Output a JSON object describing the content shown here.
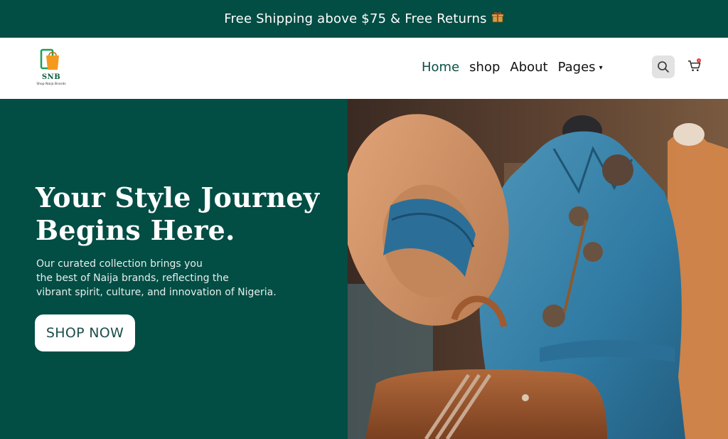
{
  "announcement": {
    "text": "Free Shipping above $75 & Free Returns",
    "icon": "gift-icon"
  },
  "brand": {
    "name": "SNB",
    "tagline": "Shop Naija Brands",
    "colors": {
      "primary": "#024d44",
      "logo_green": "#0b5a3a",
      "logo_orange": "#f39a1e"
    }
  },
  "nav": {
    "items": [
      {
        "label": "Home",
        "active": true
      },
      {
        "label": "shop"
      },
      {
        "label": "About"
      },
      {
        "label": "Pages",
        "has_dropdown": true
      }
    ],
    "dropdown_caret": "▾"
  },
  "header_actions": {
    "search_icon": "search-icon",
    "cart_icon": "cart-icon",
    "cart_count": "1"
  },
  "hero": {
    "title_lines": [
      "Your Style Journey",
      "Begins Here."
    ],
    "description_lines": [
      "Our curated collection brings you",
      "the best of Naija brands, reflecting the",
      "vibrant spirit, culture, and innovation of Nigeria."
    ],
    "cta_label": "SHOP NOW",
    "image": "fashion-mannequin-hat-bag"
  }
}
